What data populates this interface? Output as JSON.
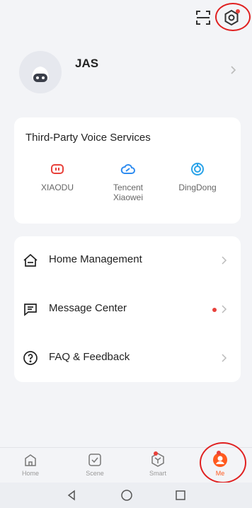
{
  "topbar": {
    "scan_icon": "scan-icon",
    "settings_icon": "settings-icon"
  },
  "profile": {
    "username": "JAS"
  },
  "voice_services": {
    "title": "Third-Party Voice Services",
    "items": [
      {
        "label": "XIAODU",
        "icon": "xiaodu-icon",
        "color": "#e8413b"
      },
      {
        "label": "Tencent Xiaowei",
        "icon": "tencent-xiaowei-icon",
        "color": "#2f8cf0"
      },
      {
        "label": "DingDong",
        "icon": "dingdong-icon",
        "color": "#2aa3e8"
      }
    ]
  },
  "menu": {
    "items": [
      {
        "label": "Home Management",
        "icon": "home-icon"
      },
      {
        "label": "Message Center",
        "icon": "message-icon",
        "badge": true
      },
      {
        "label": "FAQ & Feedback",
        "icon": "question-icon"
      }
    ]
  },
  "tabs": [
    {
      "label": "Home",
      "icon": "home-tab-icon"
    },
    {
      "label": "Scene",
      "icon": "scene-tab-icon"
    },
    {
      "label": "Smart",
      "icon": "smart-tab-icon",
      "badge": true
    },
    {
      "label": "Me",
      "icon": "me-tab-icon",
      "active": true
    }
  ],
  "colors": {
    "accent": "#ff5a1f",
    "badge": "#e8413b",
    "annotation": "#e02020"
  }
}
